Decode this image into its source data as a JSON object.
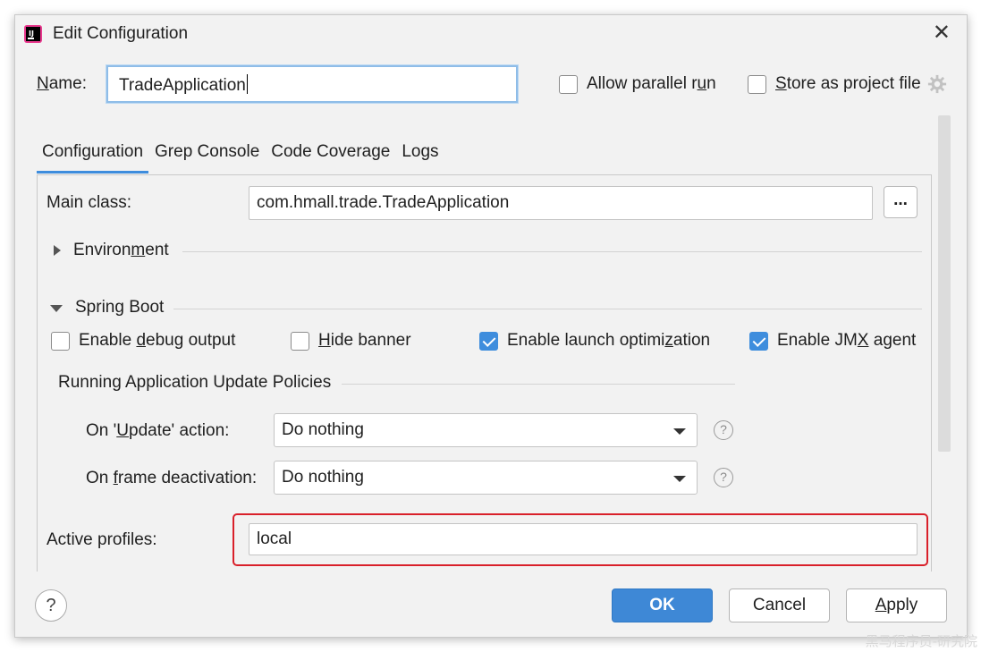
{
  "dialog": {
    "title": "Edit Configuration",
    "close_glyph": "✕",
    "icon": "intellij-app-icon"
  },
  "name_row": {
    "label_u": "N",
    "label_rest": "ame:",
    "value": "TradeApplication",
    "allow_parallel": {
      "pre": "Allow parallel r",
      "u": "u",
      "post": "n",
      "checked": false
    },
    "store_as_file": {
      "pre": "",
      "u": "S",
      "post": "tore as project file",
      "checked": false
    }
  },
  "tabs": [
    {
      "label": "Configuration",
      "active": true
    },
    {
      "label": "Grep Console",
      "active": false
    },
    {
      "label": "Code Coverage",
      "active": false
    },
    {
      "label": "Logs",
      "active": false
    }
  ],
  "main_class": {
    "label": "Main class:",
    "value": "com.hmall.trade.TradeApplication",
    "browse_label": "..."
  },
  "environment": {
    "pre": "Environ",
    "u": "m",
    "post": "ent"
  },
  "spring_boot": {
    "title": "Spring Boot",
    "options": [
      {
        "pre": "Enable ",
        "u": "d",
        "post": "ebug output",
        "checked": false
      },
      {
        "pre": "",
        "u": "H",
        "post": "ide banner",
        "checked": false
      },
      {
        "pre": "Enable launch optimi",
        "u": "z",
        "post": "ation",
        "checked": true
      },
      {
        "pre": "Enable JM",
        "u": "X",
        "post": " agent",
        "checked": true
      }
    ]
  },
  "update_policies": {
    "title": "Running Application Update Policies",
    "on_update": {
      "pre": "On '",
      "u": "U",
      "post": "pdate' action:",
      "value": "Do nothing"
    },
    "on_frame": {
      "pre": "On ",
      "u": "f",
      "post": "rame deactivation:",
      "value": "Do nothing"
    },
    "help": "?"
  },
  "active_profiles": {
    "label": "Active profiles:",
    "value": "local",
    "highlight_color": "#d9202a"
  },
  "footer": {
    "help": "?",
    "ok": "OK",
    "cancel": "Cancel",
    "apply_u": "A",
    "apply_rest": "pply"
  },
  "watermark": "黑马程序员-研究院",
  "colors": {
    "accent": "#3e8ddd",
    "primary_button": "#3e88d6",
    "background": "#f2f2f2"
  }
}
